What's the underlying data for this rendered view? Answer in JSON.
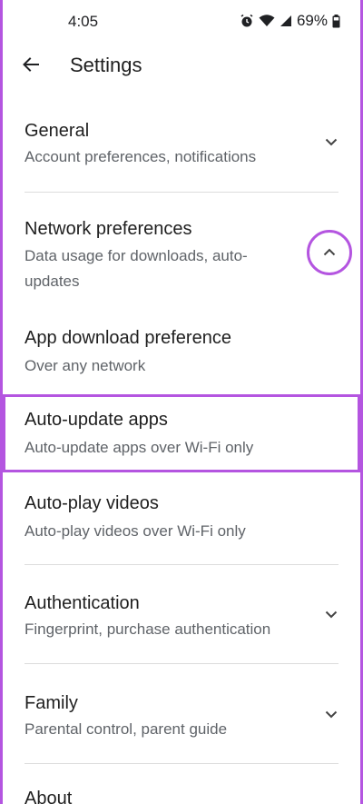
{
  "status_bar": {
    "time": "4:05",
    "battery": "69%",
    "icons": [
      "alarm-icon",
      "wifi-icon",
      "signal-icon",
      "battery-icon"
    ]
  },
  "header": {
    "title": "Settings",
    "back_icon": "arrow-left-icon"
  },
  "sections": [
    {
      "title": "General",
      "subtitle": "Account preferences, notifications",
      "chevron": "chevron-down-icon"
    },
    {
      "title": "Network preferences",
      "subtitle": "Data usage for downloads, auto-updates",
      "chevron": "chevron-up-icon"
    },
    {
      "title": "App download preference",
      "subtitle": "Over any network"
    },
    {
      "title": "Auto-update apps",
      "subtitle": "Auto-update apps over Wi-Fi only"
    },
    {
      "title": "Auto-play videos",
      "subtitle": "Auto-play videos over Wi-Fi only"
    },
    {
      "title": "Authentication",
      "subtitle": "Fingerprint, purchase authentication",
      "chevron": "chevron-down-icon"
    },
    {
      "title": "Family",
      "subtitle": "Parental control, parent guide",
      "chevron": "chevron-down-icon"
    },
    {
      "title": "About"
    }
  ],
  "colors": {
    "highlight": "#b455e0",
    "text_primary": "#1f1f1f",
    "text_secondary": "#5f6368"
  }
}
